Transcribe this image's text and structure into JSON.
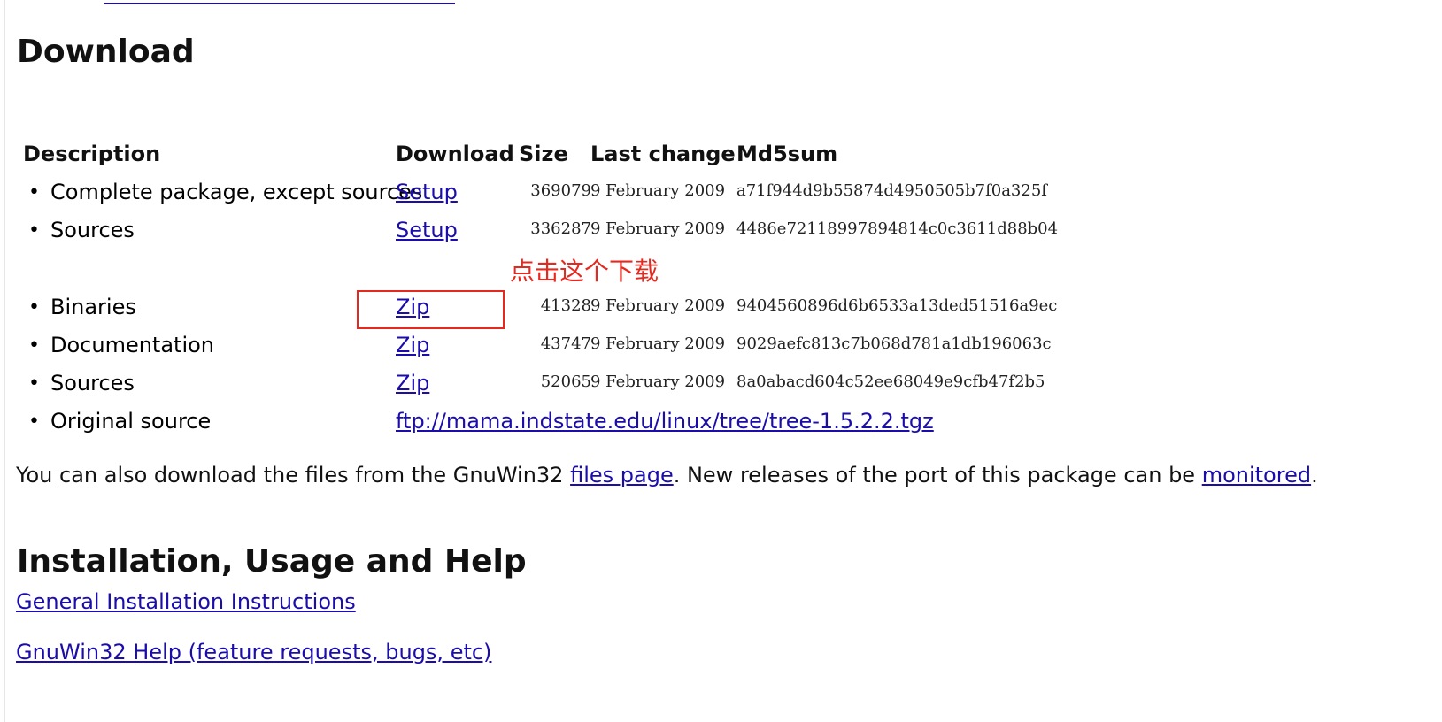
{
  "top_link_fragment": "",
  "sections": {
    "download_heading": "Download",
    "install_heading": "Installation, Usage and Help"
  },
  "table": {
    "headers": [
      "Description",
      "Download",
      "Size",
      "Last change",
      "Md5sum"
    ],
    "rows": [
      {
        "description": "Complete package, except sources",
        "link": "Setup",
        "size": "369079",
        "date": "9 February 2009",
        "md5": "a71f944d9b55874d4950505b7f0a325f"
      },
      {
        "description": "Sources",
        "link": "Setup",
        "size": "336287",
        "date": "9 February 2009",
        "md5": "4486e72118997894814c0c3611d88b04"
      },
      {
        "description": "Binaries",
        "link": "Zip",
        "size": "41328",
        "date": "9 February 2009",
        "md5": "9404560896d6b6533a13ded51516a9ec"
      },
      {
        "description": "Documentation",
        "link": "Zip",
        "size": "43747",
        "date": "9 February 2009",
        "md5": "9029aefc813c7b068d781a1db196063c"
      },
      {
        "description": "Sources",
        "link": "Zip",
        "size": "52065",
        "date": "9 February 2009",
        "md5": "8a0abacd604c52ee68049e9cfb47f2b5"
      },
      {
        "description": "Original source",
        "link": "ftp://mama.indstate.edu/linux/tree/tree-1.5.2.2.tgz"
      }
    ],
    "bullet": "•"
  },
  "annotation": {
    "text": "点击这个下载",
    "color": "#e6291f"
  },
  "paragraph": {
    "prefix": "You can also download the files from the GnuWin32 ",
    "files_link": "files page",
    "middle": ". New releases of the port of this package can be ",
    "monitored_link": "monitored",
    "suffix": "."
  },
  "help_links": {
    "general": "General Installation Instructions",
    "gnuwin_help": "GnuWin32 Help (feature requests, bugs, etc)"
  },
  "colors": {
    "link": "#1a0dab",
    "text": "#111111",
    "highlight_box": "#e6291f"
  }
}
